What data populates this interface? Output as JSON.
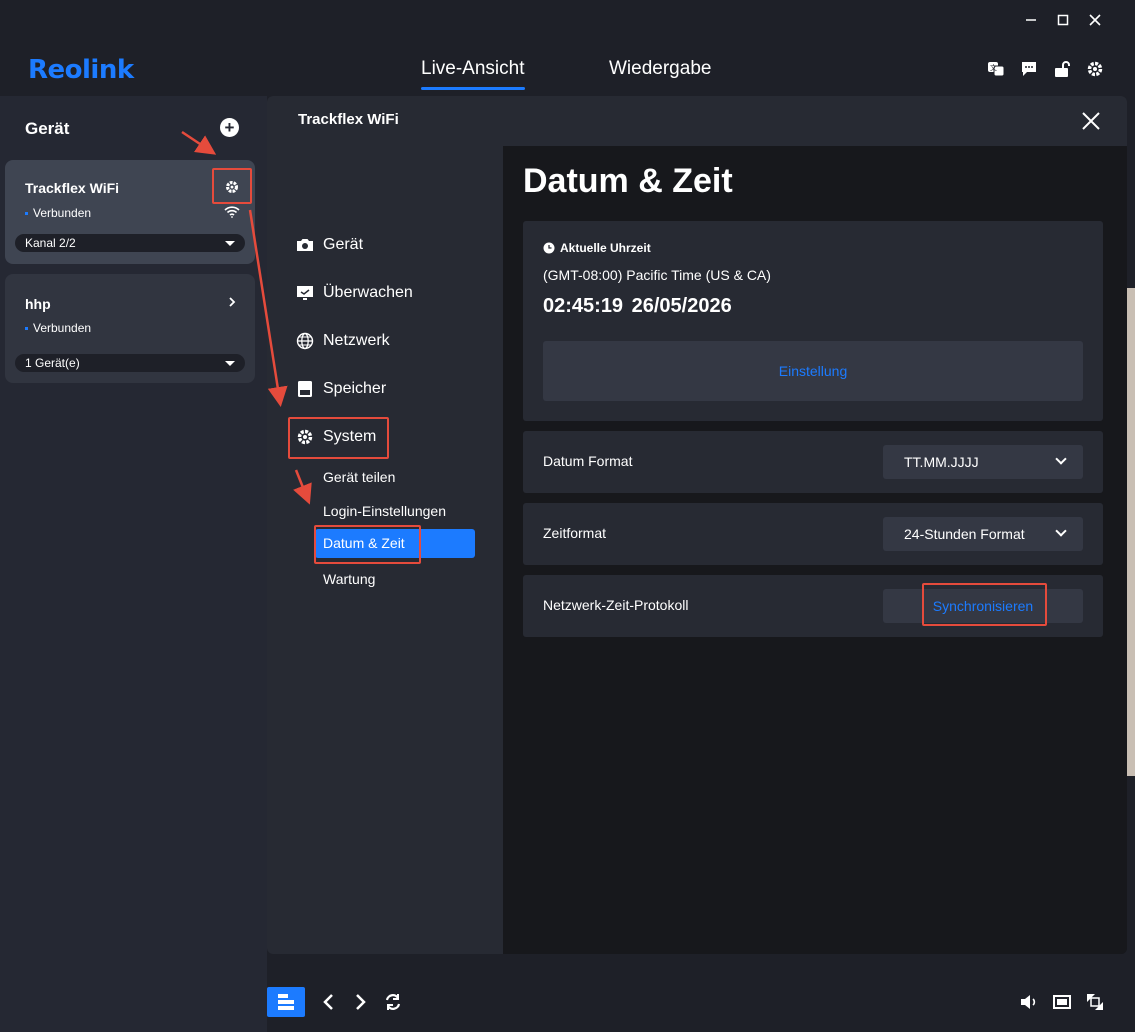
{
  "app": {
    "logo": "Reolink",
    "tabs": [
      {
        "label": "Live-Ansicht",
        "active": true
      },
      {
        "label": "Wiedergabe",
        "active": false
      }
    ],
    "window_controls": [
      "minimize",
      "maximize",
      "close"
    ],
    "header_icons": [
      "translate-icon",
      "chat-icon",
      "unlock-icon",
      "settings-icon"
    ],
    "accent": "#1c7bff"
  },
  "sidebar": {
    "title": "Gerät",
    "devices": [
      {
        "name": "Trackflex WiFi",
        "status": "Verbunden",
        "select": "Kanal 2/2"
      },
      {
        "name": "hhp",
        "status": "Verbunden",
        "select": "1 Gerät(e)"
      }
    ]
  },
  "dialog": {
    "title": "Trackflex WiFi",
    "nav": [
      {
        "label": "Gerät",
        "icon": "camera-icon"
      },
      {
        "label": "Überwachen",
        "icon": "monitor-icon"
      },
      {
        "label": "Netzwerk",
        "icon": "globe-icon"
      },
      {
        "label": "Speicher",
        "icon": "storage-icon"
      },
      {
        "label": "System",
        "icon": "gear-icon"
      }
    ],
    "system_sub": [
      {
        "label": "Gerät teilen"
      },
      {
        "label": "Login-Einstellungen"
      },
      {
        "label": "Datum & Zeit",
        "active": true
      },
      {
        "label": "Wartung"
      }
    ],
    "content": {
      "title": "Datum & Zeit",
      "current_label": "Aktuelle Uhrzeit",
      "timezone": "(GMT-08:00) Pacific Time (US & CA)",
      "time": "02:45:19",
      "date": "26/05/2026",
      "setting_button": "Einstellung",
      "date_format_label": "Datum Format",
      "date_format_value": "TT.MM.JJJJ",
      "time_format_label": "Zeitformat",
      "time_format_value": "24-Stunden Format",
      "ntp_label": "Netzwerk-Zeit-Protokoll",
      "ntp_button": "Synchronisieren"
    }
  },
  "bottom_bar": {
    "left_icons": [
      "layout-icon",
      "prev-icon",
      "next-icon",
      "refresh-icon"
    ],
    "right_icons": [
      "volume-icon",
      "screen-icon",
      "fullscreen-icon"
    ]
  },
  "annotation_color": "#e54b3c"
}
